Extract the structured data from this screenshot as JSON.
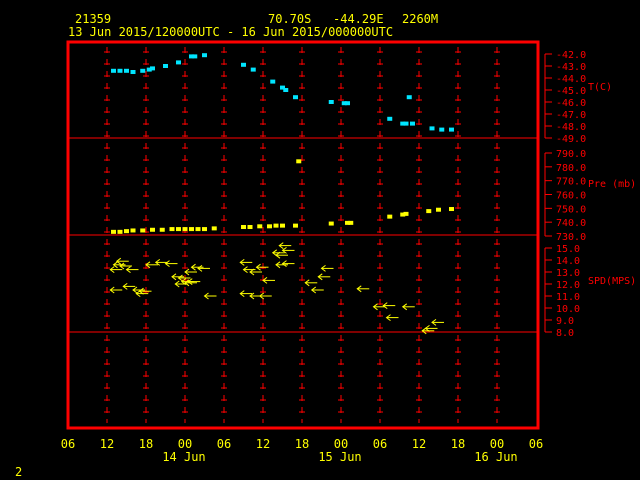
{
  "header": {
    "station_id": "21359",
    "latitude": "70.70S",
    "longitude": "-44.29E",
    "elevation": "2260M",
    "time_range": "13 Jun 2015/120000UTC - 16 Jun 2015/000000UTC"
  },
  "page_number": "2",
  "colors": {
    "background": "#000000",
    "frame": "#ff0000",
    "text": "#ffff00",
    "temperature": "#00e5ff",
    "pressure": "#ffff00",
    "wind": "#ffff00",
    "axis_labels": "#ff0000"
  },
  "chart_data": [
    {
      "type": "scatter",
      "ylabel": "T(C)",
      "ylim": [
        -49.0,
        -42.0
      ],
      "y_ticks": [
        "-42.0",
        "-43.0",
        "-44.0",
        "-45.0",
        "-46.0",
        "-47.0",
        "-48.0",
        "-49.0"
      ],
      "x_unit": "hours since 13 Jun 2015 06 UTC",
      "x": [
        7,
        8,
        9,
        10,
        11.5,
        12.5,
        13,
        14,
        15,
        16,
        17,
        18,
        22.5,
        23.5,
        24.5,
        27.5,
        29,
        31,
        32,
        33,
        34,
        35,
        37,
        42,
        43,
        44.5,
        47,
        48,
        48.5,
        55.5,
        56.5,
        59.5
      ],
      "values": [
        -43.4,
        -43.4,
        -43.4,
        -43.5,
        -43.3,
        -43.2,
        -43.2,
        -43.0,
        -42.8,
        -42.3,
        -42.2,
        -42.2,
        -42.1,
        -42.0,
        -42.2,
        -42.9,
        -43.2,
        -43.5,
        -43.8,
        -44.0,
        -44.3,
        -44.5,
        -44.8,
        -45.1,
        -45.4,
        -46.6,
        -47.2,
        -47.6,
        -48.0,
        -48.0,
        -45.6,
        -48.3
      ],
      "points": [
        [
          7,
          -43.4
        ],
        [
          8,
          -43.4
        ],
        [
          9,
          -43.4
        ],
        [
          10,
          -43.5
        ],
        [
          11.5,
          -43.4
        ],
        [
          12.5,
          -43.3
        ],
        [
          13,
          -43.2
        ],
        [
          15,
          -43.0
        ],
        [
          17,
          -42.7
        ],
        [
          19,
          -42.2
        ],
        [
          19.5,
          -42.2
        ],
        [
          21,
          -42.1
        ],
        [
          27,
          -42.9
        ],
        [
          28.5,
          -43.3
        ],
        [
          31.5,
          -44.3
        ],
        [
          33,
          -44.8
        ],
        [
          33.5,
          -45.0
        ],
        [
          35,
          -45.6
        ],
        [
          40.5,
          -46.0
        ],
        [
          42.5,
          -46.1
        ],
        [
          43,
          -46.1
        ],
        [
          49.5,
          -47.4
        ],
        [
          51.5,
          -47.8
        ],
        [
          52,
          -47.8
        ],
        [
          52.5,
          -45.6
        ],
        [
          53,
          -47.8
        ],
        [
          56,
          -48.2
        ],
        [
          57.5,
          -48.3
        ],
        [
          59,
          -48.3
        ]
      ]
    },
    {
      "type": "scatter",
      "ylabel": "Pre (mb)",
      "ylim": [
        730.0,
        790.0
      ],
      "y_ticks": [
        "790.0",
        "780.0",
        "770.0",
        "760.0",
        "750.0",
        "740.0",
        "730.0"
      ],
      "x_unit": "hours since 13 Jun 2015 06 UTC",
      "points": [
        [
          7,
          733
        ],
        [
          8,
          733
        ],
        [
          9,
          733.5
        ],
        [
          10,
          734
        ],
        [
          11.5,
          734
        ],
        [
          13,
          734.5
        ],
        [
          14.5,
          734.5
        ],
        [
          16,
          735
        ],
        [
          17,
          735
        ],
        [
          18,
          735
        ],
        [
          19,
          735
        ],
        [
          20,
          735
        ],
        [
          21,
          735
        ],
        [
          22.5,
          735.5
        ],
        [
          27,
          736.5
        ],
        [
          28,
          736.5
        ],
        [
          29.5,
          737
        ],
        [
          31,
          737
        ],
        [
          32,
          737.5
        ],
        [
          33,
          737.5
        ],
        [
          35,
          737.5
        ],
        [
          35.5,
          784
        ],
        [
          40.5,
          739
        ],
        [
          43,
          739.5
        ],
        [
          43.5,
          739.5
        ],
        [
          49.5,
          744
        ],
        [
          51.5,
          745.5
        ],
        [
          52,
          746
        ],
        [
          55.5,
          748
        ],
        [
          57,
          749
        ],
        [
          59,
          749.5
        ]
      ]
    },
    {
      "type": "scatter",
      "ylabel": "SPD(MPS)",
      "ylim": [
        8.0,
        15.0
      ],
      "y_ticks": [
        "15.0",
        "14.0",
        "13.0",
        "12.0",
        "11.0",
        "10.0",
        "9.0",
        "8.0"
      ],
      "x_unit": "hours since 13 Jun 2015 06 UTC",
      "points": [
        [
          6.5,
          13.2
        ],
        [
          7,
          13.6
        ],
        [
          7.5,
          13.9
        ],
        [
          8,
          13.5
        ],
        [
          9,
          13.2
        ],
        [
          6.5,
          11.5
        ],
        [
          8.5,
          11.8
        ],
        [
          10,
          11.5
        ],
        [
          10.5,
          11.2
        ],
        [
          11,
          11.4
        ],
        [
          12,
          13.6
        ],
        [
          13.5,
          13.8
        ],
        [
          15,
          13.7
        ],
        [
          16,
          12.6
        ],
        [
          16.5,
          12.0
        ],
        [
          17,
          12.5
        ],
        [
          17.5,
          12.2
        ],
        [
          18,
          13.0
        ],
        [
          18.5,
          12.2
        ],
        [
          19,
          13.4
        ],
        [
          20,
          13.3
        ],
        [
          18,
          12.1
        ],
        [
          21,
          11.0
        ],
        [
          26.5,
          13.8
        ],
        [
          27,
          13.2
        ],
        [
          28,
          13.0
        ],
        [
          29,
          13.4
        ],
        [
          30,
          12.3
        ],
        [
          26.5,
          11.2
        ],
        [
          28,
          11.0
        ],
        [
          29.5,
          11.0
        ],
        [
          31.5,
          14.6
        ],
        [
          32,
          14.4
        ],
        [
          32.5,
          15.2
        ],
        [
          33,
          14.8
        ],
        [
          32,
          13.6
        ],
        [
          33,
          13.7
        ],
        [
          36.5,
          12.1
        ],
        [
          37.5,
          11.5
        ],
        [
          38.5,
          12.6
        ],
        [
          39,
          13.3
        ],
        [
          44.5,
          11.6
        ],
        [
          47,
          10.1
        ],
        [
          48.5,
          10.2
        ],
        [
          49,
          9.2
        ],
        [
          51.5,
          10.1
        ],
        [
          54.5,
          8.1
        ],
        [
          55,
          8.3
        ],
        [
          56,
          8.8
        ]
      ]
    }
  ],
  "x_axis": {
    "tick_labels": [
      "06",
      "12",
      "18",
      "00",
      "06",
      "12",
      "18",
      "00",
      "06",
      "12",
      "18",
      "00",
      "06"
    ],
    "date_labels": [
      "14 Jun",
      "15 Jun",
      "16 Jun"
    ]
  }
}
